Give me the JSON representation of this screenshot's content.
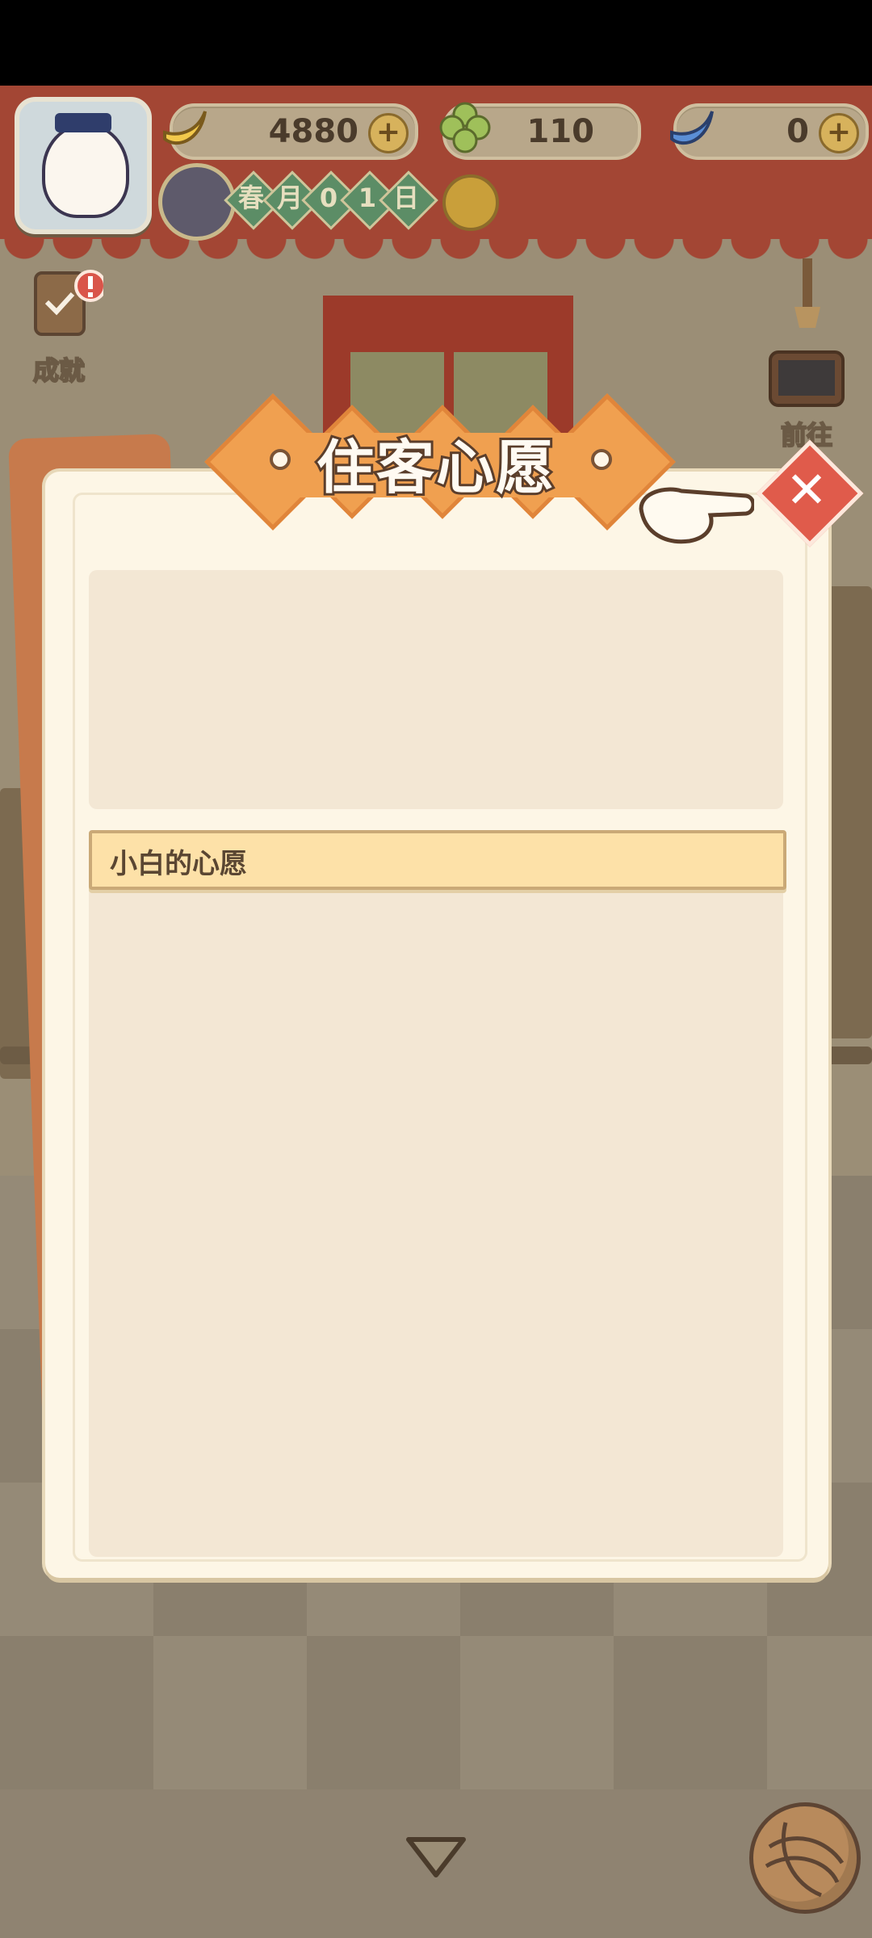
{
  "header": {
    "currencies": [
      {
        "icon": "banana-icon",
        "value": "4880",
        "has_plus": true
      },
      {
        "icon": "clover-icon",
        "value": "110",
        "has_plus": false
      },
      {
        "icon": "blue-banana-icon",
        "value": "0",
        "has_plus": true
      }
    ],
    "date": {
      "season": "春",
      "month": "月",
      "day_digits": [
        "0",
        "1"
      ],
      "day_suffix": "日"
    }
  },
  "side_buttons": {
    "achievements_label": "成就",
    "goto_label": "前往"
  },
  "dialog": {
    "title": "住客心愿",
    "wishes": [
      {
        "label": "小白的心愿"
      }
    ]
  },
  "colors": {
    "accent_orange": "#f0a050",
    "close_red": "#e05b4b",
    "panel_bg": "#fdf6e6",
    "selected_item": "#fde1a8"
  }
}
